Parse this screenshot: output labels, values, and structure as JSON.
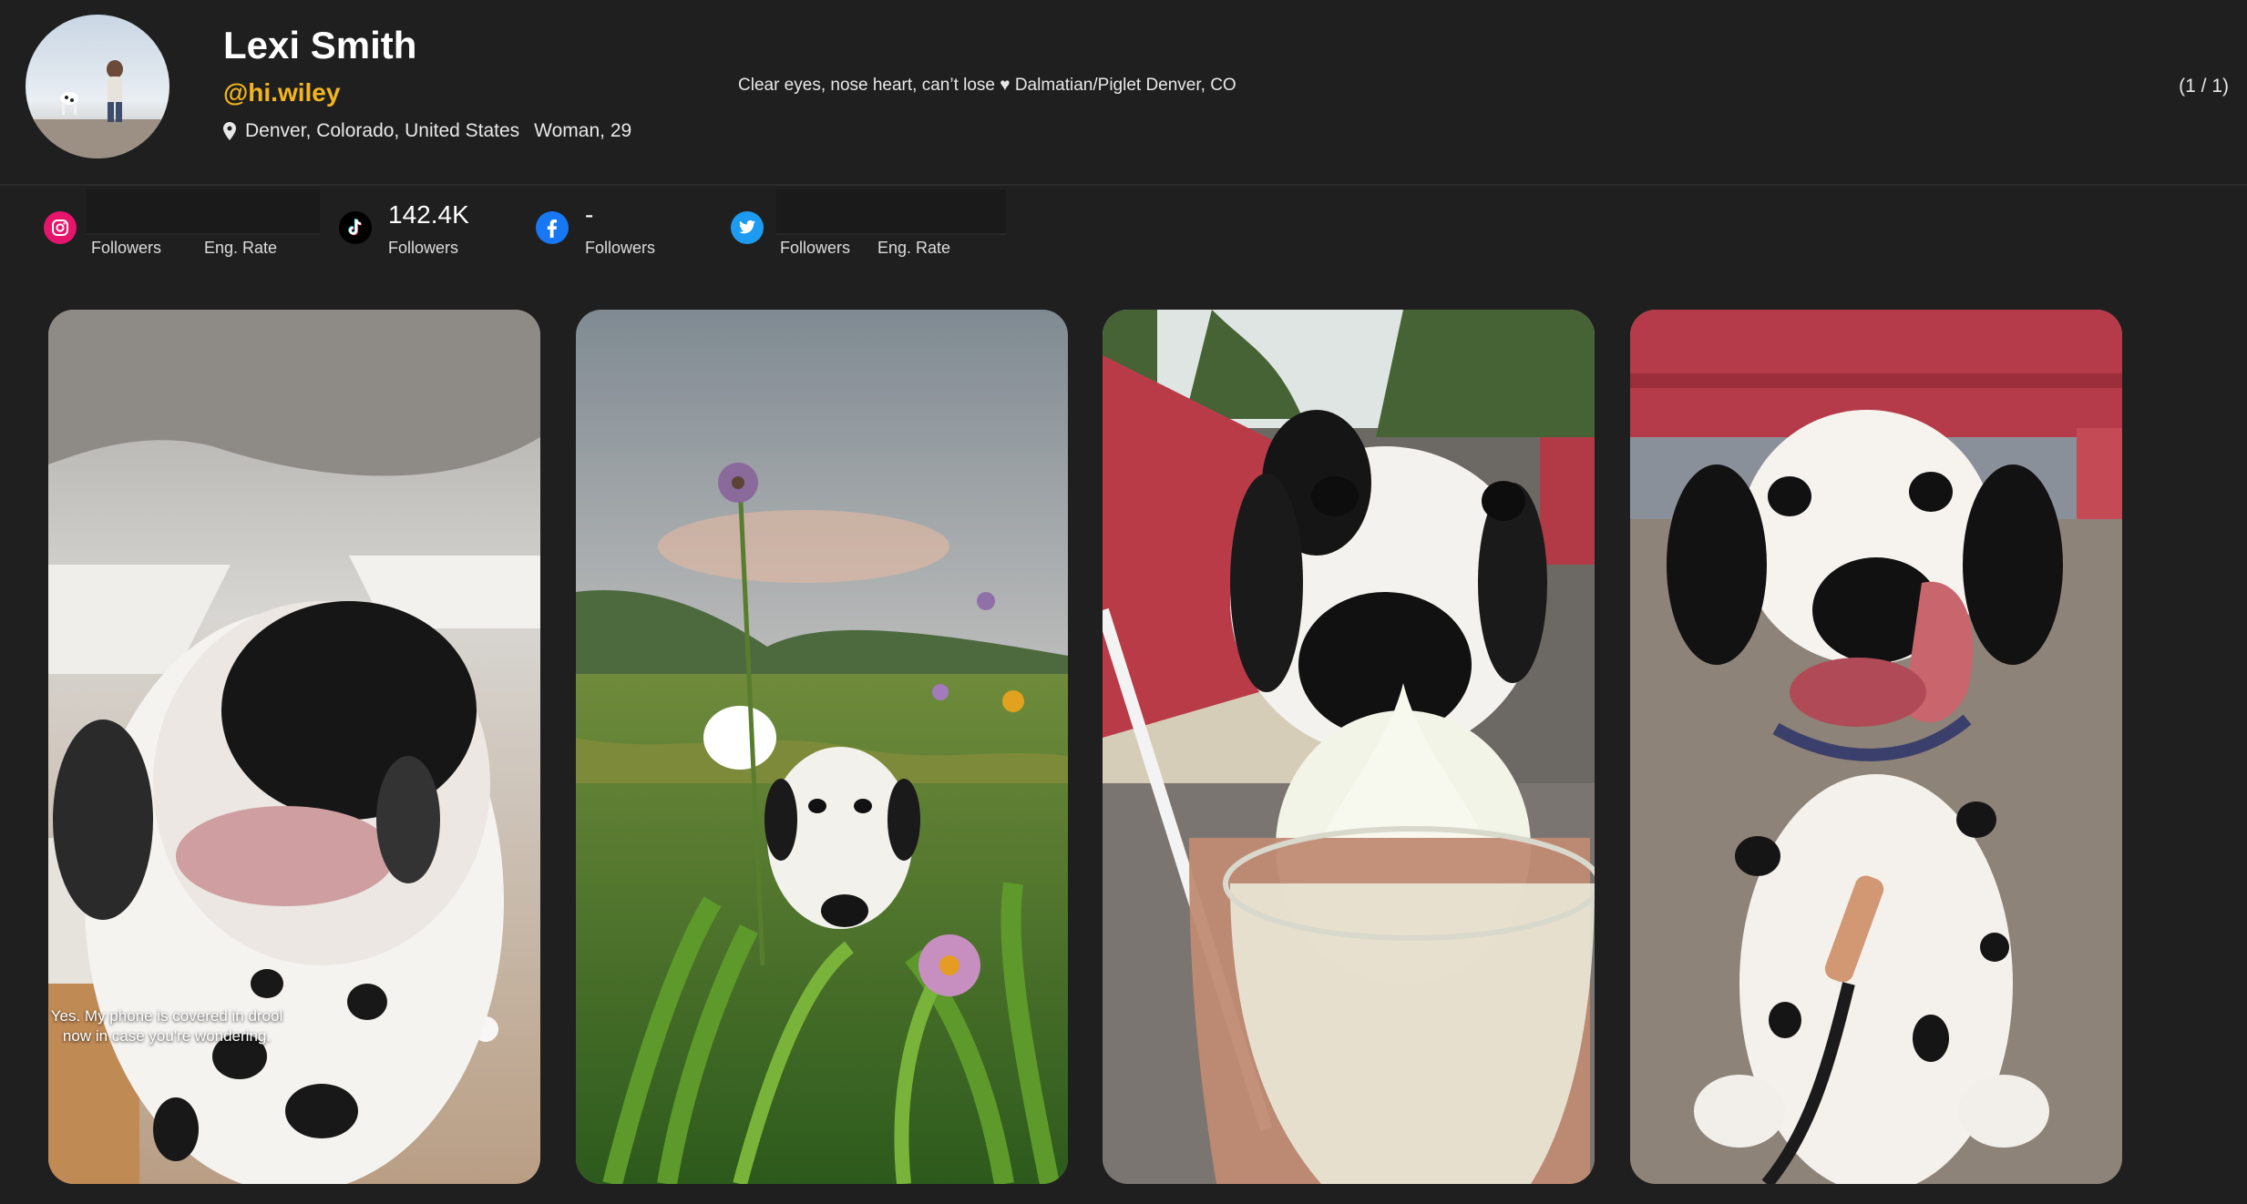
{
  "profile": {
    "name": "Lexi Smith",
    "handle": "@hi.wiley",
    "location": "Denver, Colorado, United States",
    "gender_age": "Woman, 29",
    "bio": "Clear eyes, nose heart, can’t lose ♥ Dalmatian/Piglet Denver, CO",
    "pager": "(1 / 1)"
  },
  "stats": {
    "instagram": {
      "followers_label": "Followers",
      "eng_label": "Eng. Rate",
      "color": "#e4156a"
    },
    "tiktok": {
      "value": "142.4K",
      "followers_label": "Followers",
      "color": "#000000"
    },
    "facebook": {
      "value": "-",
      "followers_label": "Followers",
      "color": "#1877f2"
    },
    "twitter": {
      "followers_label": "Followers",
      "eng_label": "Eng. Rate",
      "color": "#1d9bf0"
    }
  },
  "gallery": {
    "posts": [
      {
        "caption": "Yes. My phone is covered in drool now in case you're wondering."
      },
      {
        "caption": ""
      },
      {
        "caption": ""
      },
      {
        "caption": ""
      }
    ]
  },
  "colors": {
    "background": "#1f1f1f",
    "handle": "#f3b51f"
  }
}
